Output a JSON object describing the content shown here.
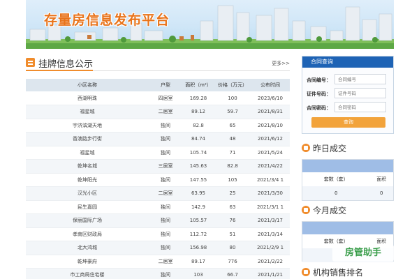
{
  "banner": {
    "title": "存量房信息发布平台"
  },
  "listings": {
    "title": "挂牌信息公示",
    "more": "更多>>",
    "columns": [
      "小区名称",
      "户型",
      "面积（m²）",
      "价格（万元）",
      "公布时间"
    ],
    "rows": [
      [
        "西湖明珠",
        "四居室",
        "169.28",
        "100",
        "2023/6/10"
      ],
      [
        "福星城",
        "二居室",
        "89.12",
        "59.7",
        "2021/8/31"
      ],
      [
        "宇济滨湖天地",
        "独间",
        "82.8",
        "65",
        "2021/8/10"
      ],
      [
        "香澳路步行街",
        "独间",
        "84.74",
        "48",
        "2021/6/12"
      ],
      [
        "福星城",
        "独间",
        "105.74",
        "71",
        "2021/5/24"
      ],
      [
        "乾坤名城",
        "三居室",
        "145.63",
        "82.8",
        "2021/4/22"
      ],
      [
        "乾坤阳光",
        "独间",
        "147.55",
        "105",
        "2021/3/4 1"
      ],
      [
        "汉光小区",
        "二居室",
        "63.95",
        "25",
        "2021/3/30"
      ],
      [
        "民生嘉园",
        "独间",
        "142.9",
        "63",
        "2021/3/1 1"
      ],
      [
        "保丽国际广场",
        "独间",
        "105.57",
        "76",
        "2021/3/17"
      ],
      [
        "孝南区财政局",
        "独间",
        "112.72",
        "51",
        "2021/3/14"
      ],
      [
        "北大鸿城",
        "独间",
        "156.98",
        "80",
        "2021/2/9 1"
      ],
      [
        "乾坤豪府",
        "二居室",
        "89.17",
        "776",
        "2021/2/22"
      ],
      [
        "市工商局住宅楼",
        "独间",
        "103",
        "66.7",
        "2021/1/21"
      ]
    ]
  },
  "contract": {
    "title": "合同查询",
    "fields": [
      {
        "label": "合同编号：",
        "placeholder": "合同编号"
      },
      {
        "label": "证件号码：",
        "placeholder": "证件号码"
      },
      {
        "label": "合同密码：",
        "placeholder": "合同密码"
      }
    ],
    "button": "查询"
  },
  "yesterday": {
    "title": "昨日成交",
    "headers": [
      "套数（套）",
      "面积"
    ],
    "values": [
      "0",
      "0"
    ]
  },
  "month": {
    "title": "今月成交",
    "headers": [
      "套数（套）",
      "面积"
    ]
  },
  "agency": {
    "title": "机构销售排名"
  },
  "watermark": "房管助手",
  "colors": {
    "primary": "#1e63b5",
    "accent": "#f08c2c",
    "button": "#f2a33b"
  }
}
